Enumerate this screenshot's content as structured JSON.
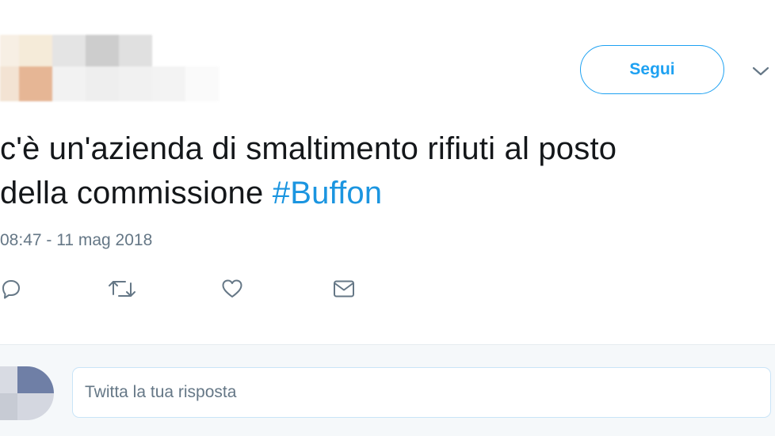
{
  "tweet": {
    "text_line1": "c'è un'azienda di smaltimento rifiuti al posto",
    "text_line2_prefix": "della commissione ",
    "hashtag": "#Buffon",
    "timestamp": "08:47 - 11 mag 2018"
  },
  "header": {
    "follow_label": "Segui"
  },
  "reply": {
    "placeholder": "Twitta la tua risposta"
  },
  "icons": {
    "reply": "reply-icon",
    "retweet": "retweet-icon",
    "like": "heart-icon",
    "dm": "envelope-icon",
    "more": "chevron-down-icon"
  },
  "colors": {
    "accent": "#1da1f2",
    "hashtag": "#1b95e0",
    "text": "#14171a",
    "muted": "#657786",
    "reply_bg": "#f5f8fa",
    "input_border": "#c9e4f7"
  }
}
